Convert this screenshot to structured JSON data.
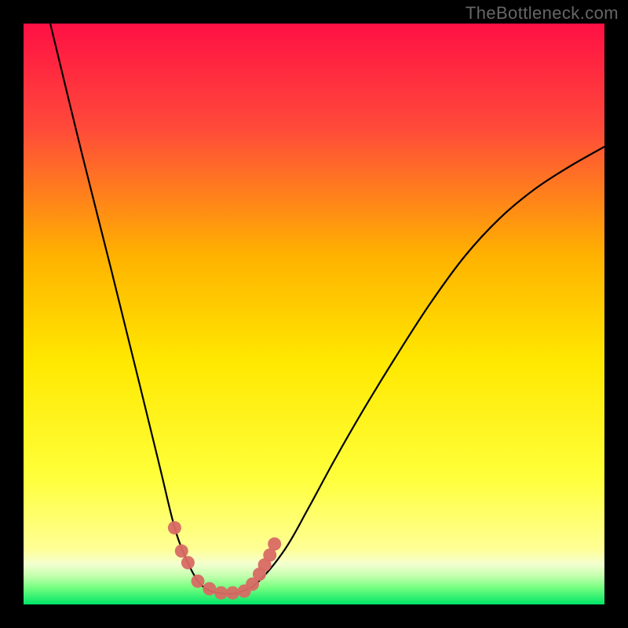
{
  "attribution": "TheBottleneck.com",
  "chart_data": {
    "type": "line",
    "title": "",
    "xlabel": "",
    "ylabel": "",
    "xlim": [
      0,
      1
    ],
    "ylim": [
      0,
      1
    ],
    "background_gradient": {
      "stops": [
        {
          "offset": 0.0,
          "color": "#ff1044"
        },
        {
          "offset": 0.18,
          "color": "#ff4a3a"
        },
        {
          "offset": 0.4,
          "color": "#ffb200"
        },
        {
          "offset": 0.58,
          "color": "#ffe800"
        },
        {
          "offset": 0.78,
          "color": "#ffff3a"
        },
        {
          "offset": 0.905,
          "color": "#ffff96"
        },
        {
          "offset": 0.93,
          "color": "#f4ffd0"
        },
        {
          "offset": 0.95,
          "color": "#c6ffb0"
        },
        {
          "offset": 0.97,
          "color": "#7aff82"
        },
        {
          "offset": 1.0,
          "color": "#00e566"
        }
      ]
    },
    "series": [
      {
        "name": "bottleneck-curve",
        "color": "#000000",
        "x": [
          0.046,
          0.1,
          0.15,
          0.2,
          0.235,
          0.258,
          0.275,
          0.295,
          0.31,
          0.322,
          0.336,
          0.355,
          0.375,
          0.405,
          0.45,
          0.49,
          0.535,
          0.585,
          0.64,
          0.7,
          0.76,
          0.82,
          0.88,
          0.94,
          1.0
        ],
        "values": [
          1.0,
          0.778,
          0.58,
          0.378,
          0.235,
          0.14,
          0.09,
          0.048,
          0.03,
          0.023,
          0.02,
          0.018,
          0.022,
          0.04,
          0.095,
          0.165,
          0.248,
          0.335,
          0.425,
          0.518,
          0.6,
          0.665,
          0.715,
          0.754,
          0.788
        ]
      },
      {
        "name": "measured-region",
        "type": "scatter",
        "color": "#d86a64",
        "r": 8.5,
        "x": [
          0.26,
          0.272,
          0.283,
          0.3,
          0.32,
          0.34,
          0.36,
          0.38,
          0.394,
          0.406,
          0.415,
          0.424,
          0.432
        ],
        "values": [
          0.132,
          0.092,
          0.072,
          0.04,
          0.027,
          0.02,
          0.02,
          0.023,
          0.035,
          0.052,
          0.068,
          0.085,
          0.104
        ]
      }
    ]
  }
}
